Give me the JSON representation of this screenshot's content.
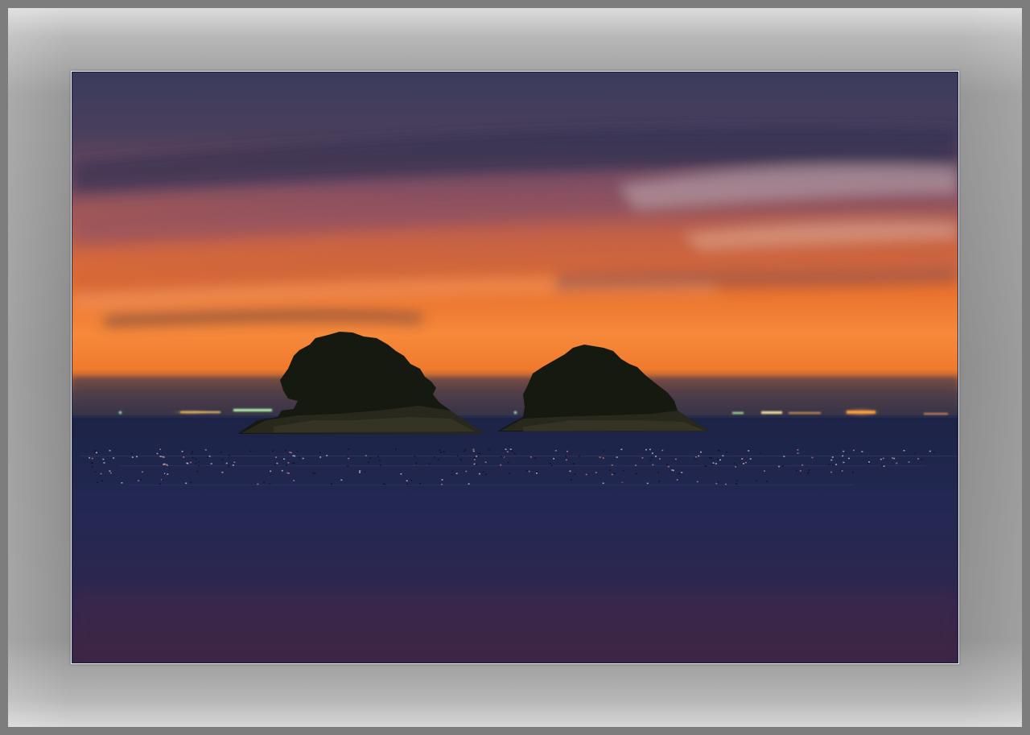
{
  "scene": {
    "subject": "twin-islands-sunset",
    "colors": {
      "sky_top": "#3a3c5c",
      "sky_magenta": "#a85a6e",
      "sky_orange": "#f07a2a",
      "horizon_glow": "#ff8a30",
      "sea_dark": "#1e2448",
      "sea_purple": "#3a2a4a",
      "island": "#1a1e14",
      "mat": "#9a9a9a"
    }
  }
}
